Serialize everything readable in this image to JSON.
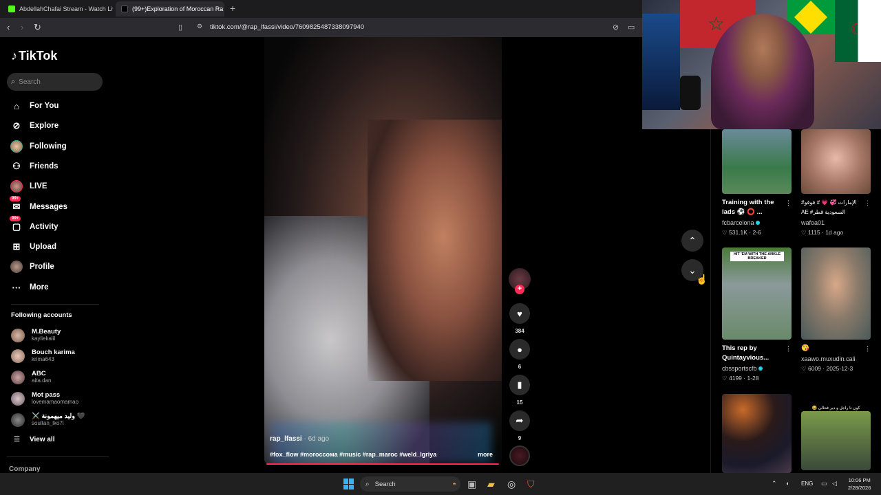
{
  "browser": {
    "tabs": [
      {
        "label": "AbdellahChafai Stream - Watch Live"
      },
      {
        "label": "(99+)Exploration of Moroccan Ra"
      }
    ],
    "url": "tiktok.com/@rap_lfassi/video/7609825487338097940"
  },
  "sidebar": {
    "logo": "TikTok",
    "search_placeholder": "Search",
    "items": [
      {
        "label": "For You",
        "icon": "home-icon"
      },
      {
        "label": "Explore",
        "icon": "compass-icon"
      },
      {
        "label": "Following",
        "icon": "avatar"
      },
      {
        "label": "Friends",
        "icon": "friends-icon"
      },
      {
        "label": "LIVE",
        "icon": "live-avatar"
      },
      {
        "label": "Messages",
        "icon": "message-icon",
        "badge": "99+"
      },
      {
        "label": "Activity",
        "icon": "inbox-icon",
        "badge": "99+"
      },
      {
        "label": "Upload",
        "icon": "upload-icon"
      },
      {
        "label": "Profile",
        "icon": "avatar"
      },
      {
        "label": "More",
        "icon": "more-icon"
      }
    ],
    "following_title": "Following accounts",
    "accounts": [
      {
        "name": "M.Beauty",
        "handle": "kayliekalil"
      },
      {
        "name": "Bouch karima",
        "handle": "krima643"
      },
      {
        "name": "ABC",
        "handle": "aita.dan"
      },
      {
        "name": "Mot pass",
        "handle": "lovemamaomamao"
      },
      {
        "name": "⚔️ وليد ميهمونة 🖤",
        "handle": "soultan_lko7i"
      }
    ],
    "view_all": "View all",
    "company": "Company"
  },
  "video": {
    "username": "rap_lfassi",
    "date": " · 6d ago",
    "tags": "#fox_flow #moroccoмa #music #rap_maroc #weld_lgriya",
    "more": "more",
    "progress": 0.98,
    "likes": "384",
    "comments": "6",
    "saves": "15",
    "shares": "9"
  },
  "feed": [
    {
      "title": "Training with the lads ⚽ ⭕ ...",
      "author": "fcbarcelona",
      "verified": true,
      "likes": "531.1K",
      "date": "2-6"
    },
    {
      "title": "#الإمارات 💞 💗 # فوقو AE #السعودية قطر SA_BH...",
      "author": "wafoa01",
      "verified": false,
      "likes": "1115",
      "date": "1d ago"
    },
    {
      "title": "This rep by Quintayvious...",
      "author": "cbssportscfb",
      "verified": true,
      "likes": "4199",
      "date": "1-28",
      "thumb_text": "HIT 'EM WITH THE ANKLE BREAKER"
    },
    {
      "title": "😘",
      "author": "xaawo.muxudin.cali",
      "verified": false,
      "likes": "6009",
      "date": "2025-12-3"
    },
    {
      "title": "",
      "author": "",
      "verified": false,
      "likes": "",
      "date": ""
    },
    {
      "title": "",
      "author": "",
      "verified": false,
      "likes": "",
      "date": "",
      "thumb_text": "😂 كون تا راجل و دير فحالي"
    }
  ],
  "taskbar": {
    "search": "Search",
    "lang": "ENG",
    "time": "10:06 PM",
    "date": "2/28/2026"
  },
  "colors": {
    "accent": "#fe2c55",
    "verified": "#20d5ec",
    "background": "#000000"
  }
}
